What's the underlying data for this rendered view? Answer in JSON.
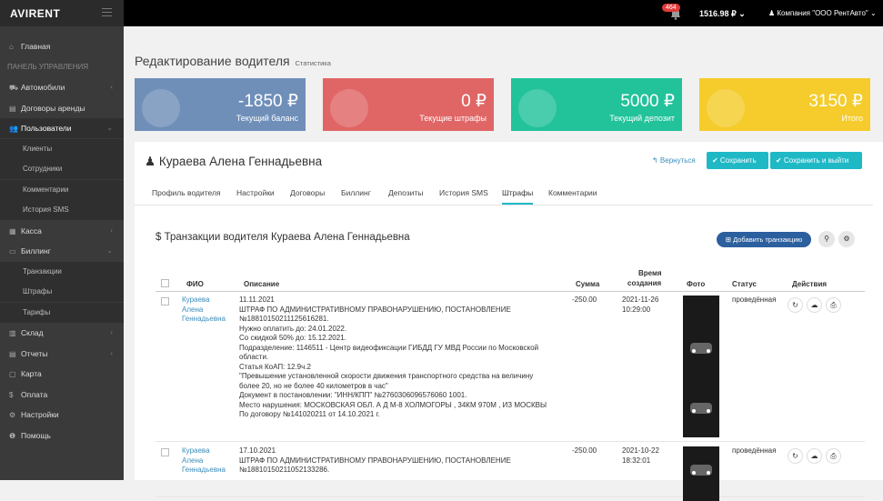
{
  "topbar": {
    "logo": "AVIRENT",
    "notifications": "464",
    "balance": "1516.98 ₽ ⌄",
    "company": "♟ Компания \"ООО РентАвто\" ⌄"
  },
  "sidebar": {
    "items": [
      {
        "icon": "⌂",
        "label": "Главная"
      },
      {
        "label": "ПАНЕЛЬ УПРАВЛЕНИЯ"
      },
      {
        "icon": "⛟",
        "label": "Автомобили",
        "chev": "‹"
      },
      {
        "icon": "▤",
        "label": "Договоры аренды"
      },
      {
        "icon": "👥",
        "label": "Пользователи",
        "chev": "⌄"
      },
      {
        "label": "Клиенты"
      },
      {
        "label": "Сотрудники"
      },
      {
        "label": "Комментарии"
      },
      {
        "label": "История SMS"
      },
      {
        "icon": "▦",
        "label": "Касса",
        "chev": "‹"
      },
      {
        "icon": "▭",
        "label": "Биллинг",
        "chev": "⌄"
      },
      {
        "label": "Транзакции"
      },
      {
        "label": "Штрафы"
      },
      {
        "label": "Тарифы"
      },
      {
        "icon": "▥",
        "label": "Склад",
        "chev": "‹"
      },
      {
        "icon": "▤",
        "label": "Отчеты",
        "chev": "‹"
      },
      {
        "icon": "▢",
        "label": "Карта"
      },
      {
        "icon": "$",
        "label": "Оплата"
      },
      {
        "icon": "⚙",
        "label": "Настройки"
      },
      {
        "icon": "❶",
        "label": "Помощь"
      }
    ]
  },
  "page": {
    "title": "Редактирование водителя",
    "subtitle": "Статистика"
  },
  "cards": [
    {
      "amount": "-1850 ₽",
      "label": "Текущий баланс",
      "color": "#6f8fb9"
    },
    {
      "amount": "0 ₽",
      "label": "Текущие штрафы",
      "color": "#e06666"
    },
    {
      "amount": "5000 ₽",
      "label": "Текущий депозит",
      "color": "#22c29a"
    },
    {
      "amount": "3150 ₽",
      "label": "Итого",
      "color": "#f5cc2b"
    }
  ],
  "driver": {
    "name": "♟ Кураева Алена Геннадьевна",
    "back": "↰ Вернуться",
    "save": "✔ Сохранить",
    "save_exit": "✔ Сохранить и выйти"
  },
  "tabs": [
    "Профиль водителя",
    "Настройки",
    "Договоры",
    "Биллинг",
    "Депозиты",
    "История SMS",
    "Штрафы",
    "Комментарии"
  ],
  "transactions": {
    "title": "$ Транзакции водителя Кураева Алена Геннадьевна",
    "add_button": "⊞ Добавить транзакцию",
    "search_icon": "⚲",
    "settings_icon": "⚙",
    "headers": {
      "fio": "ФИО",
      "desc": "Описание",
      "sum": "Сумма",
      "date1": "Время",
      "date2": "создания",
      "photo": "Фото",
      "status": "Статус",
      "actions": "Действия"
    },
    "rows": [
      {
        "fio": "Кураева Алена Геннадьевна",
        "desc": [
          "11.11.2021",
          "ШТРАФ ПО АДМИНИСТРАТИВНОМУ ПРАВОНАРУШЕНИЮ, ПОСТАНОВЛЕНИЕ",
          "№18810150211125616281.",
          "Нужно оплатить до: 24.01.2022.",
          "Со скидкой 50% до: 15.12.2021.",
          "Подразделение: 1146511 - Центр видеофиксации ГИБДД ГУ МВД России по Московской",
          "области.",
          "Статья КоАП: 12.9ч.2",
          "\"Превышение установленной скорости движения транспортного средства на величину",
          "более 20, но не более 40 километров в час\"",
          "Документ в постановлении: \"ИНН/КПП\" №2760306096576060 1001.",
          "Место нарушения: МОСКОВСКАЯ ОБЛ. А Д М-8 ХОЛМОГОРЫ , 34КМ 970М , ИЗ МОСКВЫ",
          "По договору №141020211 от 14.10.2021 г."
        ],
        "sum": "-250.00",
        "date": "2021-11-26",
        "time": "10:29:00",
        "status": "проведённая"
      },
      {
        "fio": "Кураева Алена Геннадьевна",
        "desc": [
          "17.10.2021",
          "ШТРАФ ПО АДМИНИСТРАТИВНОМУ ПРАВОНАРУШЕНИЮ, ПОСТАНОВЛЕНИЕ",
          "№18810150211052133286."
        ],
        "sum": "-250.00",
        "date": "2021-10-22",
        "time": "18:32:01",
        "status": "проведённая"
      }
    ],
    "actions": [
      "↻",
      "☁",
      "⎙"
    ]
  }
}
